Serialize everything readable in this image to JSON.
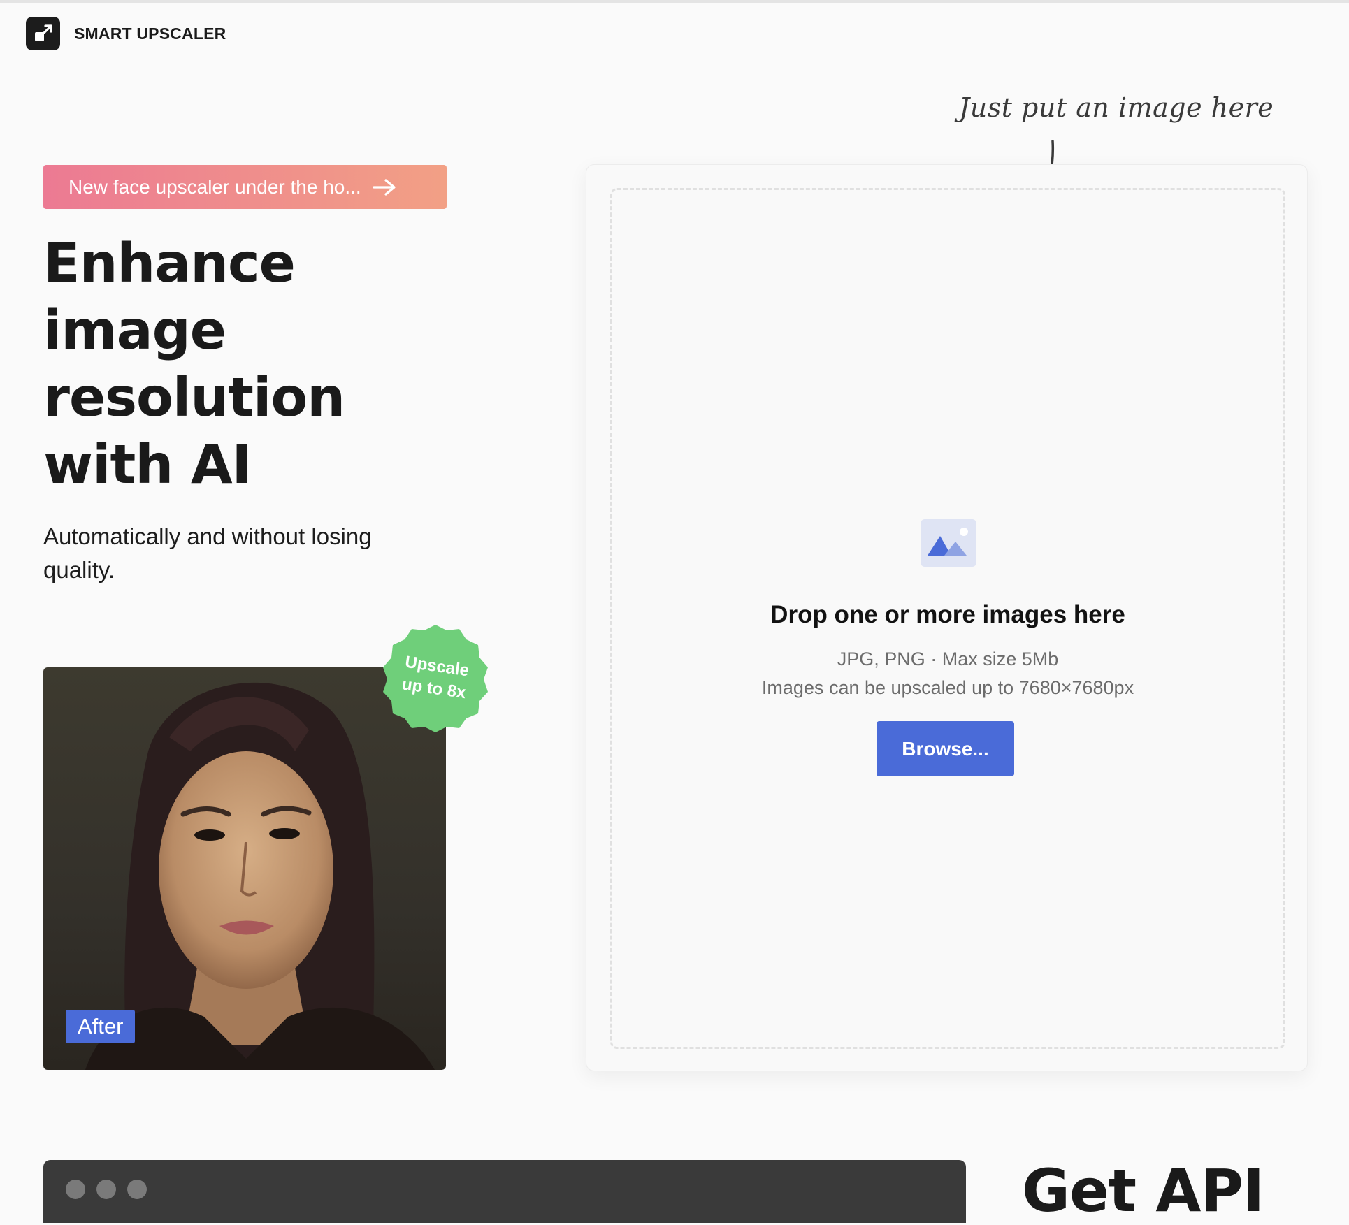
{
  "header": {
    "brand_name": "SMART UPSCALER",
    "logo_icon": "expand-arrow-icon"
  },
  "promo": {
    "label": "New face upscaler under the ho...",
    "icon": "arrow-right-icon",
    "gradient": [
      "#ec7a93",
      "#f2a085"
    ]
  },
  "hero": {
    "title_lines": [
      "Enhance",
      "image",
      "resolution",
      "with AI"
    ],
    "subtitle": "Automatically and without losing quality."
  },
  "sample": {
    "after_label": "After",
    "badge_line1": "Upscale",
    "badge_line2": "up to 8x",
    "badge_color": "#6fcf7a"
  },
  "dropzone": {
    "hint": "Just put an image here",
    "icon": "image-placeholder-icon",
    "title": "Drop one or more images here",
    "formats": "JPG, PNG · Max size 5Mb",
    "limit": "Images can be upscaled up to 7680×7680px",
    "browse_label": "Browse...",
    "accent": "#4a6bd8"
  },
  "api": {
    "title": "Get API"
  }
}
